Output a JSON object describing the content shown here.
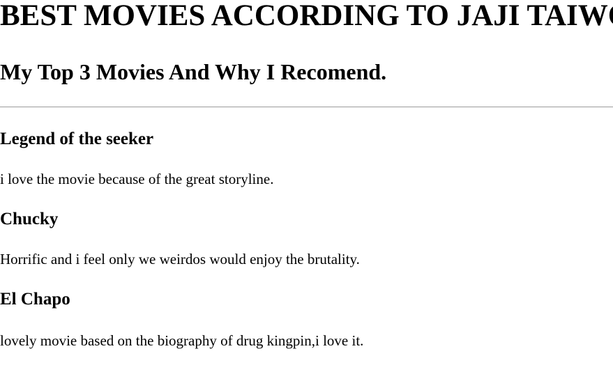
{
  "header": {
    "title": "BEST MOVIES ACCORDING TO JAJI TAIWO",
    "subtitle": "My Top 3 Movies And Why I Recomend."
  },
  "movies": [
    {
      "title": "Legend of the seeker",
      "description": "i love the movie because of the great storyline."
    },
    {
      "title": "Chucky",
      "description": "Horrific and i feel only we weirdos would enjoy the brutality."
    },
    {
      "title": "El Chapo",
      "description": "lovely movie based on the biography of drug kingpin,i love it."
    }
  ]
}
